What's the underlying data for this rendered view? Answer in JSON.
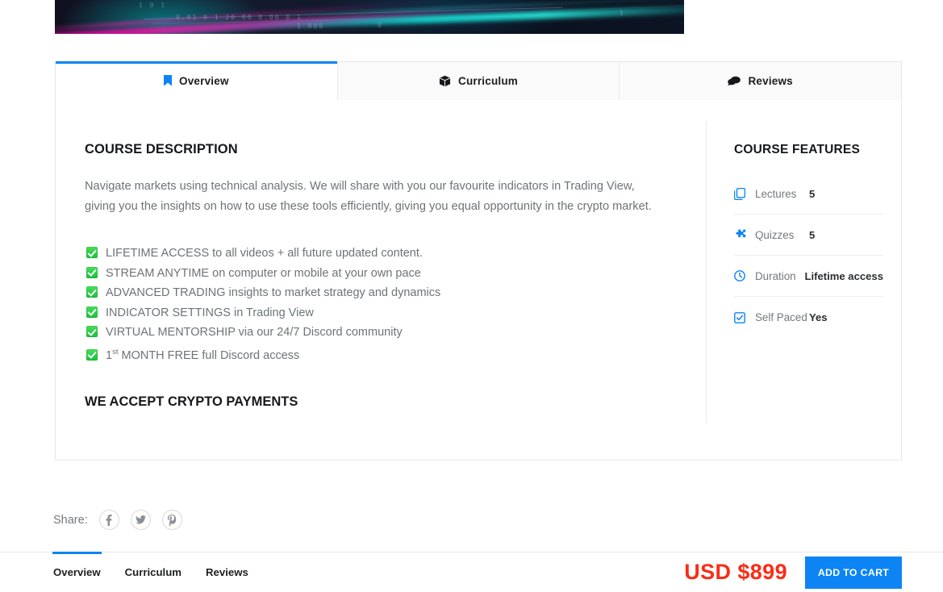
{
  "banner": {
    "alt": "crypto trading chart banner",
    "ticks": [
      "1 0 1",
      "0.01 0 1  20  00  0.00 0 1",
      "1 000",
      "0",
      "1"
    ]
  },
  "tabs": [
    {
      "label": "Overview",
      "icon": "bookmark-icon",
      "active": true
    },
    {
      "label": "Curriculum",
      "icon": "cube-icon",
      "active": false
    },
    {
      "label": "Reviews",
      "icon": "comment-icon",
      "active": false
    }
  ],
  "overview": {
    "description_heading": "COURSE DESCRIPTION",
    "description": "Navigate markets using technical analysis. We will share with you our favourite indicators in Trading View, giving you the insights on how to use these tools efficiently, giving you equal opportunity in the crypto market.",
    "features": [
      {
        "text": "LIFETIME ACCESS to all videos + all future updated content."
      },
      {
        "text": "STREAM ANYTIME on computer or mobile at your own pace"
      },
      {
        "text": "ADVANCED TRADING insights to market strategy and dynamics"
      },
      {
        "text": "INDICATOR SETTINGS in Trading View"
      },
      {
        "text": "VIRTUAL MENTORSHIP via our 24/7 Discord community"
      },
      {
        "prefix": "1",
        "sup": "st",
        "text": " MONTH FREE full Discord access"
      }
    ],
    "crypto_heading": "WE ACCEPT CRYPTO PAYMENTS"
  },
  "course_features": {
    "title": "COURSE FEATURES",
    "rows": [
      {
        "icon": "copy-icon",
        "label": "Lectures",
        "value": "5"
      },
      {
        "icon": "puzzle-icon",
        "label": "Quizzes",
        "value": "5"
      },
      {
        "icon": "clock-icon",
        "label": "Duration",
        "value": "Lifetime access"
      },
      {
        "icon": "checkbox-icon",
        "label": "Self Paced",
        "value": "Yes"
      }
    ]
  },
  "share": {
    "label": "Share:",
    "buttons": [
      {
        "name": "facebook-share-button",
        "glyph": "f"
      },
      {
        "name": "twitter-share-button",
        "glyph": "t"
      },
      {
        "name": "pinterest-share-button",
        "glyph": "P"
      }
    ]
  },
  "bottom_bar": {
    "nav": [
      {
        "label": "Overview",
        "active": true
      },
      {
        "label": "Curriculum",
        "active": false
      },
      {
        "label": "Reviews",
        "active": false
      }
    ],
    "price": "USD $899",
    "cart_label": "ADD TO CART"
  },
  "colors": {
    "accent": "#0d84f3",
    "price": "#fb2c15",
    "check": "#17c23a"
  }
}
